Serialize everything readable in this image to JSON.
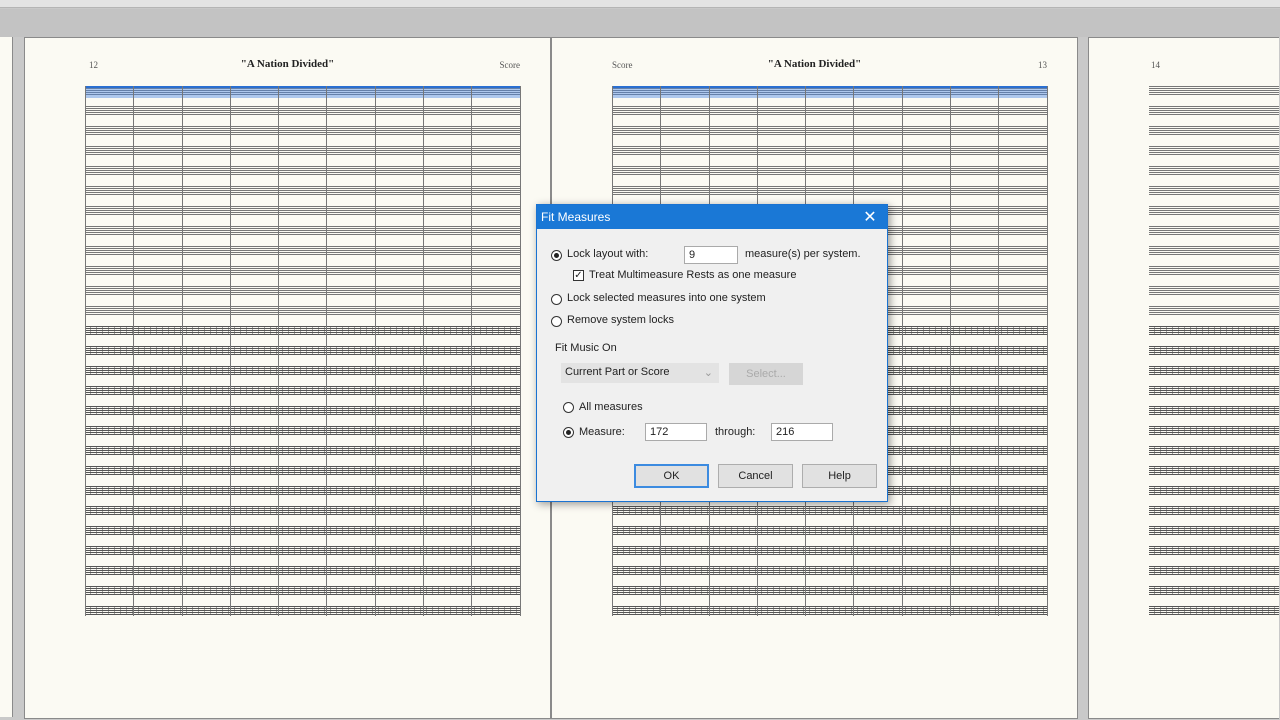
{
  "dialog": {
    "title": "Fit Measures",
    "lock_layout_label": "Lock layout with:",
    "measures_per_system_value": "9",
    "measures_per_system_suffix": "measure(s) per system.",
    "treat_multimeasure_label": "Treat Multimeasure Rests as one measure",
    "treat_multimeasure_checked": true,
    "lock_selected_label": "Lock selected measures into one system",
    "remove_locks_label": "Remove system locks",
    "selected_option": "lock_layout",
    "fit_music_on_label": "Fit Music On",
    "fit_music_on_value": "Current Part or Score",
    "select_button": "Select...",
    "all_measures_label": "All measures",
    "measure_label": "Measure:",
    "range_option": "measure",
    "measure_from": "172",
    "through_label": "through:",
    "measure_to": "216",
    "ok": "OK",
    "cancel": "Cancel",
    "help": "Help"
  },
  "pages": [
    {
      "number": "12",
      "title": "\"A Nation Divided\"",
      "label": "Score"
    },
    {
      "number": "13",
      "title": "\"A Nation Divided\"",
      "label": "Score"
    },
    {
      "number": "14"
    }
  ]
}
